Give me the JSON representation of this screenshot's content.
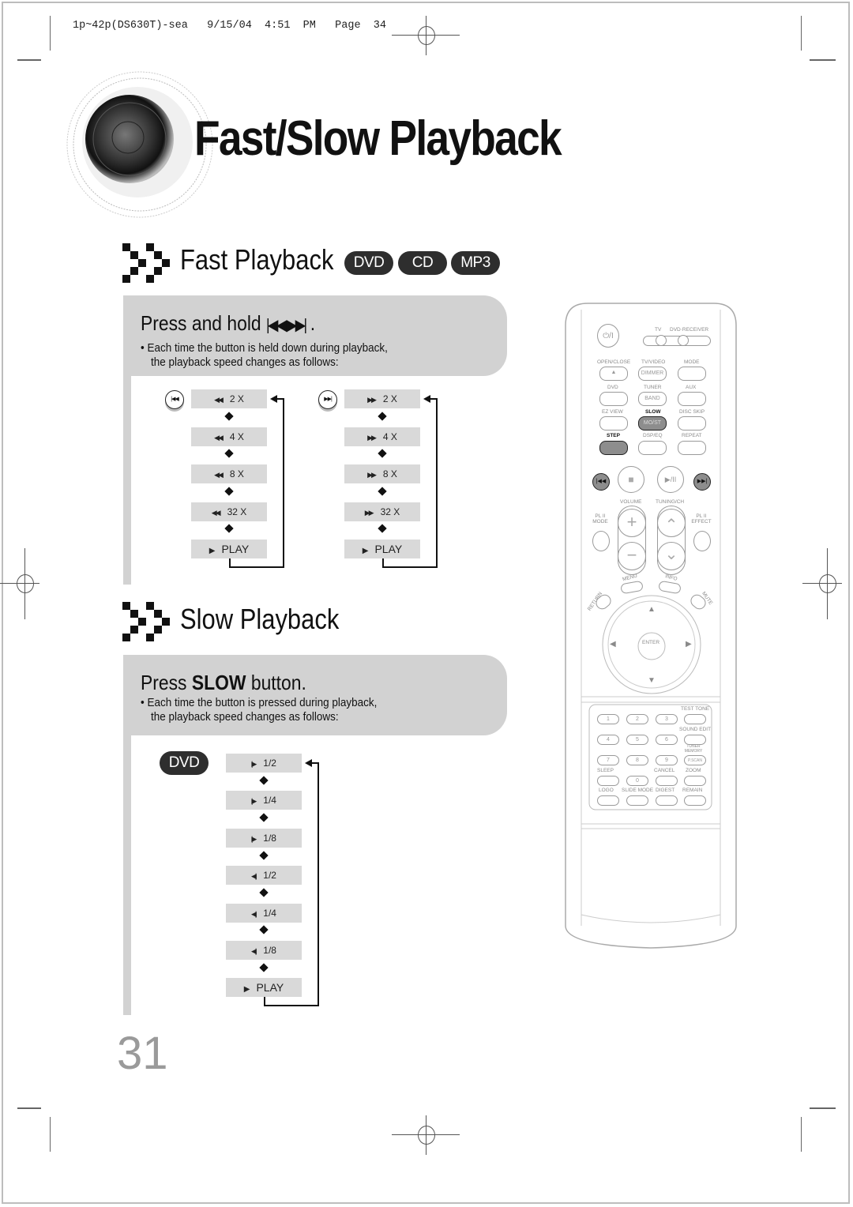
{
  "slug": "1p~42p(DS630T)-sea   9/15/04  4:51  PM   Page  34",
  "title": "Fast/Slow Playback",
  "fast": {
    "heading": "Fast Playback",
    "badges": [
      "DVD",
      "CD",
      "MP3"
    ],
    "instruction": "Press and hold",
    "instruction_icons": [
      "skip-back-icon",
      "skip-forward-icon"
    ],
    "bullet": "• Each time the button is held down during playback,",
    "bullet_line2": "the playback speed changes as follows:",
    "rewind_steps": [
      {
        "symbol": "◀◀",
        "label": "2 X"
      },
      {
        "symbol": "◀◀",
        "label": "4 X"
      },
      {
        "symbol": "◀◀",
        "label": "8 X"
      },
      {
        "symbol": "◀◀",
        "label": "32 X"
      },
      {
        "symbol": "▶",
        "label": "PLAY"
      }
    ],
    "forward_steps": [
      {
        "symbol": "▶▶",
        "label": "2 X"
      },
      {
        "symbol": "▶▶",
        "label": "4 X"
      },
      {
        "symbol": "▶▶",
        "label": "8 X"
      },
      {
        "symbol": "▶▶",
        "label": "32 X"
      },
      {
        "symbol": "▶",
        "label": "PLAY"
      }
    ],
    "rewind_button_glyph": "|◀◀",
    "forward_button_glyph": "▶▶|"
  },
  "slow": {
    "heading": "Slow Playback",
    "instruction_pre": "Press ",
    "instruction_bold": "SLOW",
    "instruction_post": " button.",
    "bullet": "• Each time the button is pressed during playback,",
    "bullet_line2": "the playback speed changes as follows:",
    "badge": "DVD",
    "steps": [
      {
        "symbol": "|▶",
        "label": "1/2"
      },
      {
        "symbol": "|▶",
        "label": "1/4"
      },
      {
        "symbol": "|▶",
        "label": "1/8"
      },
      {
        "symbol": "◀|",
        "label": "1/2"
      },
      {
        "symbol": "◀|",
        "label": "1/4"
      },
      {
        "symbol": "◀|",
        "label": "1/8"
      },
      {
        "symbol": "▶",
        "label": "PLAY"
      }
    ]
  },
  "page_number": "31",
  "remote": {
    "power": "⏻/I",
    "tv": "TV",
    "dvd_receiver": "DVD·RECEIVER",
    "open_close": "OPEN/CLOSE",
    "eject": "▲",
    "tv_video": "TV/VIDEO",
    "dimmer": "DIMMER",
    "mode": "MODE",
    "dvd": "DVD",
    "tuner": "TUNER",
    "band": "BAND",
    "aux": "AUX",
    "ez_view": "EZ VIEW",
    "slow": "SLOW",
    "mo_st": "MO/ST",
    "disc_skip": "DISC SKIP",
    "step": "STEP",
    "dsp_eq": "DSP/EQ",
    "repeat": "REPEAT",
    "prev": "|◀◀",
    "stop": "■",
    "play_pause": "▶/II",
    "next": "▶▶|",
    "volume": "VOLUME",
    "tuning_ch": "TUNING/CH",
    "pl2_mode": "PL II MODE",
    "pl2_effect": "PL II EFFECT",
    "plus": "+",
    "minus": "−",
    "up": "⌃",
    "down": "⌄",
    "menu": "MENU",
    "info": "INFO",
    "return": "RETURN",
    "mute": "MUTE",
    "enter": "ENTER",
    "test_tone": "TEST TONE",
    "sound_edit": "SOUND EDIT",
    "tuner_memory": "TUNER MEMORY",
    "pscan": "P.SCAN",
    "sleep": "SLEEP",
    "cancel": "CANCEL",
    "zoom": "ZOOM",
    "logo": "LOGO",
    "slide_mode": "SLIDE MODE",
    "digest": "DIGEST",
    "remain": "REMAIN",
    "digits": [
      "1",
      "2",
      "3",
      "4",
      "5",
      "6",
      "7",
      "8",
      "9",
      "0"
    ]
  }
}
